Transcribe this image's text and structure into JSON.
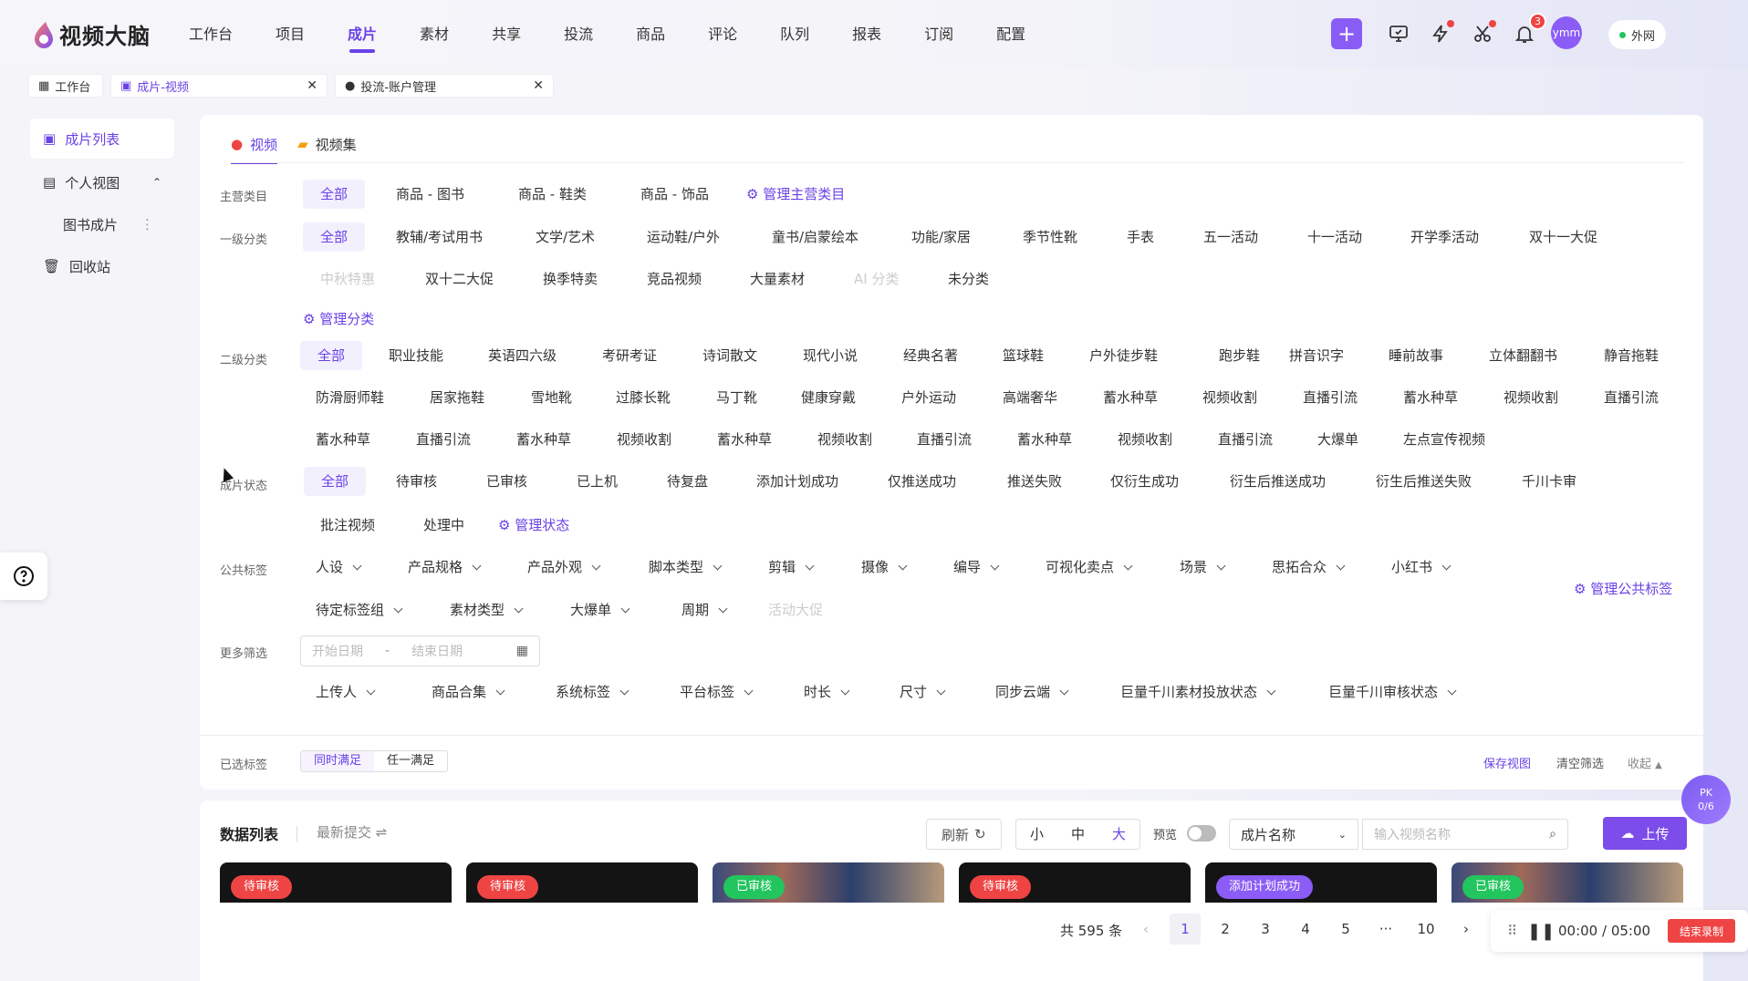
{
  "app": {
    "logo_text": "视频大脑"
  },
  "nav": [
    "工作台",
    "项目",
    "成片",
    "素材",
    "共享",
    "投流",
    "商品",
    "评论",
    "队列",
    "报表",
    "订阅",
    "配置"
  ],
  "header": {
    "notif_count": "3",
    "avatar": "ymm",
    "network": "外网"
  },
  "tabs": [
    {
      "label": "工作台"
    },
    {
      "label": "成片-视频"
    },
    {
      "label": "投流-账户管理"
    }
  ],
  "sidebar": {
    "items": [
      "成片列表",
      "个人视图",
      "图书成片",
      "回收站"
    ]
  },
  "panel_tabs": [
    "视频",
    "视频集"
  ],
  "filters": {
    "main_label": "主营类目",
    "main": [
      "全部",
      "商品 - 图书",
      "商品 - 鞋类",
      "商品 - 饰品"
    ],
    "main_manage": "管理主营类目",
    "lvl1_label": "一级分类",
    "lvl1_row1": [
      "全部",
      "教辅/考试用书",
      "文学/艺术",
      "运动鞋/户外",
      "童书/启蒙绘本",
      "功能/家居",
      "季节性靴",
      "手表",
      "五一活动",
      "十一活动",
      "开学季活动",
      "双十一大促"
    ],
    "lvl1_row2": [
      "中秋特惠",
      "双十二大促",
      "换季特卖",
      "竞品视频",
      "大量素材",
      "AI 分类",
      "未分类"
    ],
    "lvl1_manage": "管理分类",
    "lvl2_label": "二级分类",
    "lvl2_row1": [
      "全部",
      "职业技能",
      "英语四六级",
      "考研考证",
      "诗词散文",
      "现代小说",
      "经典名著",
      "篮球鞋",
      "户外徒步鞋",
      "跑步鞋",
      "拼音识字",
      "睡前故事",
      "立体翻翻书",
      "静音拖鞋"
    ],
    "lvl2_row2": [
      "防滑厨师鞋",
      "居家拖鞋",
      "雪地靴",
      "过膝长靴",
      "马丁靴",
      "健康穿戴",
      "户外运动",
      "高端奢华",
      "蓄水种草",
      "视频收割",
      "直播引流",
      "蓄水种草",
      "视频收割",
      "直播引流"
    ],
    "lvl2_row3": [
      "蓄水种草",
      "直播引流",
      "蓄水种草",
      "视频收割",
      "蓄水种草",
      "视频收割",
      "直播引流",
      "蓄水种草",
      "视频收割",
      "直播引流",
      "大爆单",
      "左点宣传视频"
    ],
    "status_label": "成片状态",
    "status_row1": [
      "全部",
      "待审核",
      "已审核",
      "已上机",
      "待复盘",
      "添加计划成功",
      "仅推送成功",
      "推送失败",
      "仅衍生成功",
      "衍生后推送成功",
      "衍生后推送失败",
      "千川卡审"
    ],
    "status_row2": [
      "批注视频",
      "处理中"
    ],
    "status_manage": "管理状态",
    "tag_label": "公共标签",
    "tags_row1": [
      "人设",
      "产品规格",
      "产品外观",
      "脚本类型",
      "剪辑",
      "摄像",
      "编导",
      "可视化卖点",
      "场景",
      "思拓合众",
      "小红书"
    ],
    "tags_row2": [
      "待定标签组",
      "素材类型",
      "大爆单",
      "周期"
    ],
    "tags_disabled": "活动大促",
    "tag_manage": "管理公共标签",
    "more_label": "更多筛选",
    "date_start": "开始日期",
    "date_end": "结束日期",
    "more_row": [
      "上传人",
      "商品合集",
      "系统标签",
      "平台标签",
      "时长",
      "尺寸",
      "同步云端",
      "巨量千川素材投放状态",
      "巨量千川审核状态"
    ],
    "selected_label": "已选标签",
    "match_all": "同时满足",
    "match_any": "任一满足",
    "save_view": "保存视图",
    "clear": "清空筛选",
    "collapse": "收起"
  },
  "list": {
    "title": "数据列表",
    "sort": "最新提交",
    "refresh": "刷新",
    "sizes": [
      "小",
      "中",
      "大"
    ],
    "preview": "预览",
    "field": "成片名称",
    "search_placeholder": "输入视频名称",
    "upload": "上传",
    "cards": [
      {
        "status": "待审核",
        "color": "#ef4444"
      },
      {
        "status": "待审核",
        "color": "#ef4444"
      },
      {
        "status": "已审核",
        "color": "#22c55e"
      },
      {
        "status": "待审核",
        "color": "#ef4444"
      },
      {
        "status": "添加计划成功",
        "color": "#8b5cf6"
      },
      {
        "status": "已审核",
        "color": "#22c55e"
      }
    ],
    "total": "共 595 条",
    "pages": [
      "1",
      "2",
      "3",
      "4",
      "5",
      "···",
      "10"
    ]
  },
  "recorder": {
    "time": "00:00  /  05:00",
    "stop": "结束录制"
  },
  "pk": {
    "line1": "PK",
    "line2": "0/6"
  },
  "colors": {
    "accent": "#6a42e6",
    "danger": "#ef4444",
    "success": "#22c55e"
  }
}
